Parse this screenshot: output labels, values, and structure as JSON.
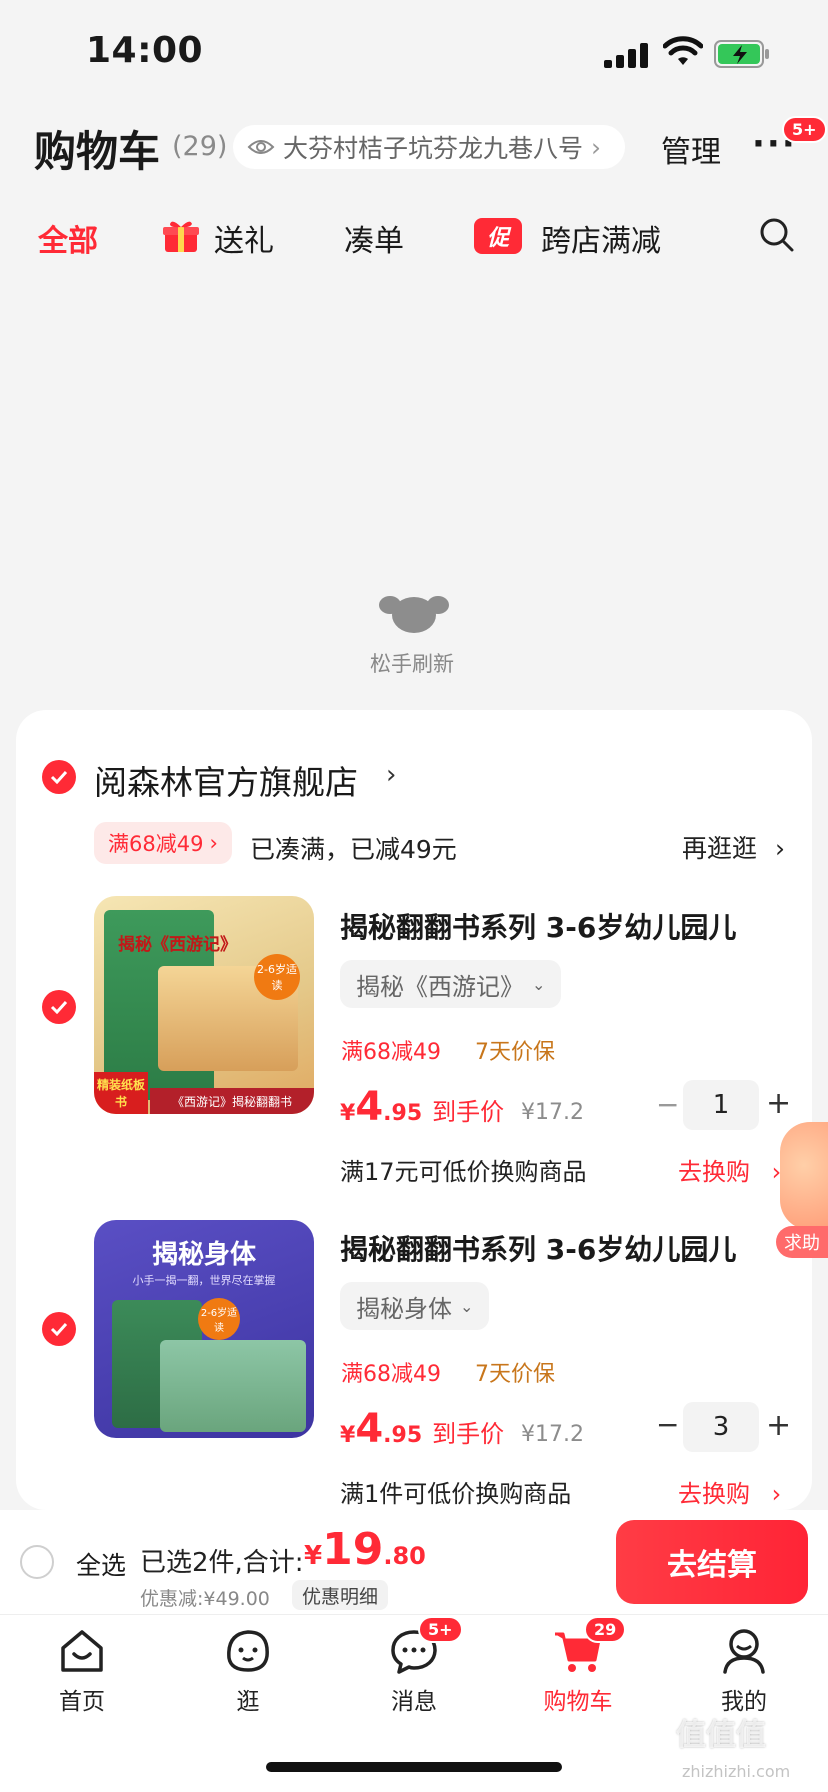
{
  "status_bar": {
    "time": "14:00"
  },
  "header": {
    "title": "购物车",
    "count": "(29)",
    "address": "大芬村桔子坑芬龙九巷八号",
    "manage": "管理",
    "more_badge": "5+"
  },
  "filters": {
    "all": "全部",
    "gift": "送礼",
    "combo": "凑单",
    "promo_tag": "促",
    "cross_store": "跨店满减"
  },
  "pull_refresh": "松手刷新",
  "store": {
    "name": "阅森林官方旗舰店",
    "deal_pill": "满68减49",
    "deal_status": "已凑满，已减49元",
    "browse": "再逛逛"
  },
  "items": [
    {
      "title": "揭秘翻翻书系列 3-6岁幼儿园儿",
      "variant": "揭秘《西游记》",
      "discount": "满68减49",
      "price_protect": "7天价保",
      "price_yen": "¥",
      "price_int": "4",
      "price_dec": ".95",
      "price_label": "到手价",
      "orig_price": "¥17.2",
      "qty": "1",
      "swap_text": "满17元可低价换购商品",
      "swap_link": "去换购",
      "cover_top": "揭秘《西游记》",
      "cover_tag": "2-6岁适读",
      "cover_corner": "精装纸板书",
      "cover_bottom": "《西游记》揭秘翻翻书"
    },
    {
      "title": "揭秘翻翻书系列 3-6岁幼儿园儿",
      "variant": "揭秘身体",
      "discount": "满68减49",
      "price_protect": "7天价保",
      "price_yen": "¥",
      "price_int": "4",
      "price_dec": ".95",
      "price_label": "到手价",
      "orig_price": "¥17.2",
      "qty": "3",
      "swap_text": "满1件可低价换购商品",
      "swap_link": "去换购",
      "cover_top": "揭秘身体",
      "cover_sub": "小手一揭一翻，世界尽在掌握",
      "cover_tag": "2-6岁适读"
    }
  ],
  "side_tag": "求助",
  "checkout": {
    "select_all": "全选",
    "selected": "已选2件,合计:",
    "total_yen": "¥",
    "total_int": "19",
    "total_dec": ".80",
    "saved": "优惠减:¥49.00",
    "details": "优惠明细",
    "button": "去结算"
  },
  "tabbar": {
    "home": "首页",
    "browse": "逛",
    "messages": "消息",
    "messages_badge": "5+",
    "cart": "购物车",
    "cart_badge": "29",
    "mine": "我的"
  },
  "watermark": {
    "text": "值值值",
    "url": "zhizhizhi.com"
  },
  "colors": {
    "accent": "#ff2a36",
    "price_protect": "#c8761b",
    "background": "#f4f4f4"
  }
}
